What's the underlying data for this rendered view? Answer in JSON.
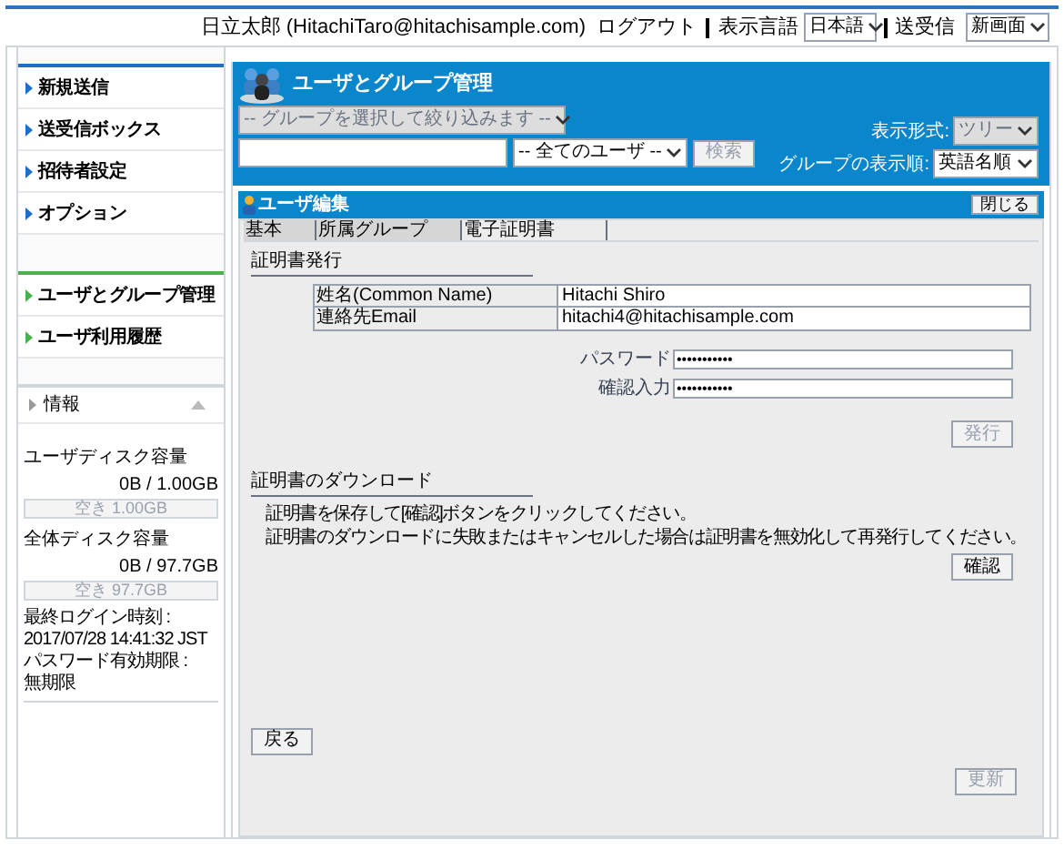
{
  "header": {
    "user": "日立太郎 (HitachiTaro@hitachisample.com)",
    "logout": "ログアウト",
    "language_label": "表示言語",
    "language_value": "日本語",
    "send_label": "送受信",
    "send_value": "新画面"
  },
  "sidebar": {
    "groups": [
      {
        "color": "#1f6fc5",
        "items": [
          "新規送信",
          "送受信ボックス",
          "招待者設定",
          "オプション"
        ]
      },
      {
        "color": "#4caf50",
        "items": [
          "ユーザとグループ管理",
          "ユーザ利用履歴"
        ]
      }
    ],
    "info": {
      "title": "情報",
      "expanded": true,
      "meters": [
        {
          "label": "ユーザディスク容量",
          "usage": "0B / 1.00GB",
          "level": 0,
          "free": "空き 1.00GB"
        },
        {
          "label": "全体ディスク容量",
          "usage": "0B / 97.7GB",
          "level": 0,
          "free": "空き 97.7GB"
        }
      ],
      "lines": [
        "最終ログイン時刻 :",
        "2017/07/28 14:41:32 JST",
        "パスワード有効期限 :",
        "無期限"
      ]
    }
  },
  "panel": {
    "title": "ユーザとグループ管理",
    "group_filter": {
      "value": "-- グループを選択して絞り込みます --",
      "disabled": true
    },
    "user_filter": {
      "value": "-- 全てのユーザ --",
      "disabled": false
    },
    "search_button": {
      "label": "検索",
      "disabled": true
    },
    "view_label": "表示形式:",
    "view": {
      "value": "ツリー",
      "disabled": true
    },
    "order_label": "グループの表示順:",
    "order": {
      "value": "英語名順",
      "disabled": false
    }
  },
  "editor": {
    "title": "ユーザ編集",
    "close": "閉じる",
    "tabs": [
      {
        "label": "基本",
        "selected": false
      },
      {
        "label": "所属グループ",
        "selected": false
      },
      {
        "label": "電子証明書",
        "selected": true
      }
    ],
    "issue": {
      "heading": "証明書発行",
      "rows": [
        {
          "label": "姓名(Common Name)",
          "value": "Hitachi Shiro"
        },
        {
          "label": "連絡先Email",
          "value": "hitachi4@hitachisample.com"
        }
      ],
      "passwords": [
        {
          "label": "パスワード",
          "value": "•••••••••••"
        },
        {
          "label": "確認入力",
          "value": "•••••••••••"
        }
      ],
      "button": {
        "label": "発行",
        "disabled": true
      }
    },
    "download": {
      "heading": "証明書のダウンロード",
      "lines": [
        "証明書を保存して[確認]ボタンをクリックしてください。",
        "証明書のダウンロードに失敗またはキャンセルした場合は証明書を無効化して再発行してください。"
      ],
      "button": {
        "label": "確認",
        "disabled": false
      }
    },
    "back": {
      "label": "戻る",
      "disabled": false
    },
    "update": {
      "label": "更新",
      "disabled": true
    }
  }
}
